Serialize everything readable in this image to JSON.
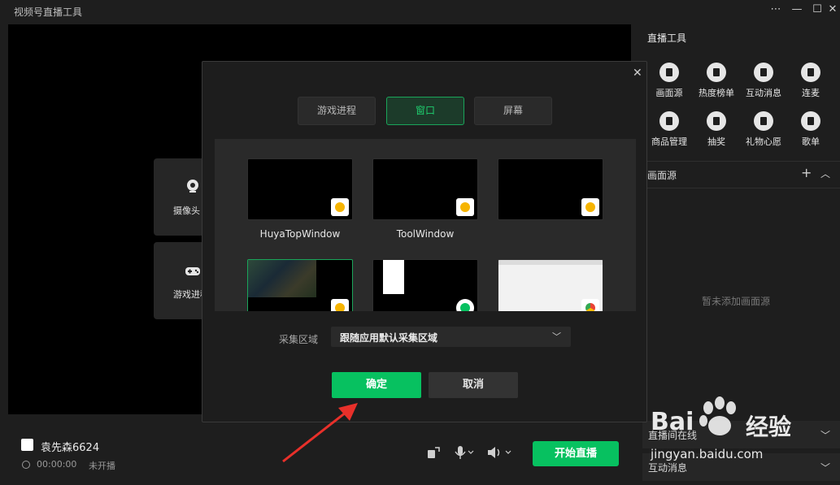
{
  "window": {
    "title": "视频号直播工具",
    "controls": [
      "⋯",
      "—",
      "☐",
      "✕"
    ]
  },
  "stage": {
    "sources": [
      {
        "label": "摄像头",
        "icon": "camera-icon"
      },
      {
        "label": "游戏进程",
        "icon": "gamepad-icon"
      }
    ]
  },
  "bottom": {
    "username": "袁先森6624",
    "timer": "00:00:00",
    "status": "未开播",
    "start_label": "开始直播"
  },
  "tools_panel": {
    "title": "直播工具",
    "tools": [
      {
        "label": "画面源",
        "icon": "source-icon"
      },
      {
        "label": "热度榜单",
        "icon": "list-icon"
      },
      {
        "label": "互动消息",
        "icon": "chat-icon"
      },
      {
        "label": "连麦",
        "icon": "phone-icon"
      },
      {
        "label": "商品管理",
        "icon": "bag-icon"
      },
      {
        "label": "抽奖",
        "icon": "gift-icon"
      },
      {
        "label": "礼物心愿",
        "icon": "heart-icon"
      },
      {
        "label": "歌单",
        "icon": "music-icon"
      }
    ],
    "source_section": "画面源",
    "empty_hint": "暂未添加画面源",
    "collapsed_sections": [
      "直播间在线",
      "互动消息"
    ]
  },
  "dialog": {
    "tabs": [
      {
        "label": "游戏进程",
        "active": false
      },
      {
        "label": "窗口",
        "active": true
      },
      {
        "label": "屏幕",
        "active": false
      }
    ],
    "windows": [
      {
        "label": "HuyaTopWindow",
        "app": "huya",
        "selected": false
      },
      {
        "label": "ToolWindow",
        "app": "huya",
        "selected": false
      },
      {
        "label": "",
        "app": "huya",
        "selected": false
      },
      {
        "label": "",
        "app": "huya",
        "selected": true
      },
      {
        "label": "",
        "app": "wechat",
        "selected": false
      },
      {
        "label": "",
        "app": "chrome",
        "selected": false
      }
    ],
    "capture_label": "采集区域",
    "capture_value": "跟随应用默认采集区域",
    "ok_label": "确定",
    "cancel_label": "取消"
  },
  "watermark": {
    "brand": "Bai",
    "brand_cn": "经验",
    "url": "jingyan.baidu.com"
  },
  "colors": {
    "accent": "#07c160",
    "bg": "#1e1e1e",
    "huya": "#f6b400"
  }
}
